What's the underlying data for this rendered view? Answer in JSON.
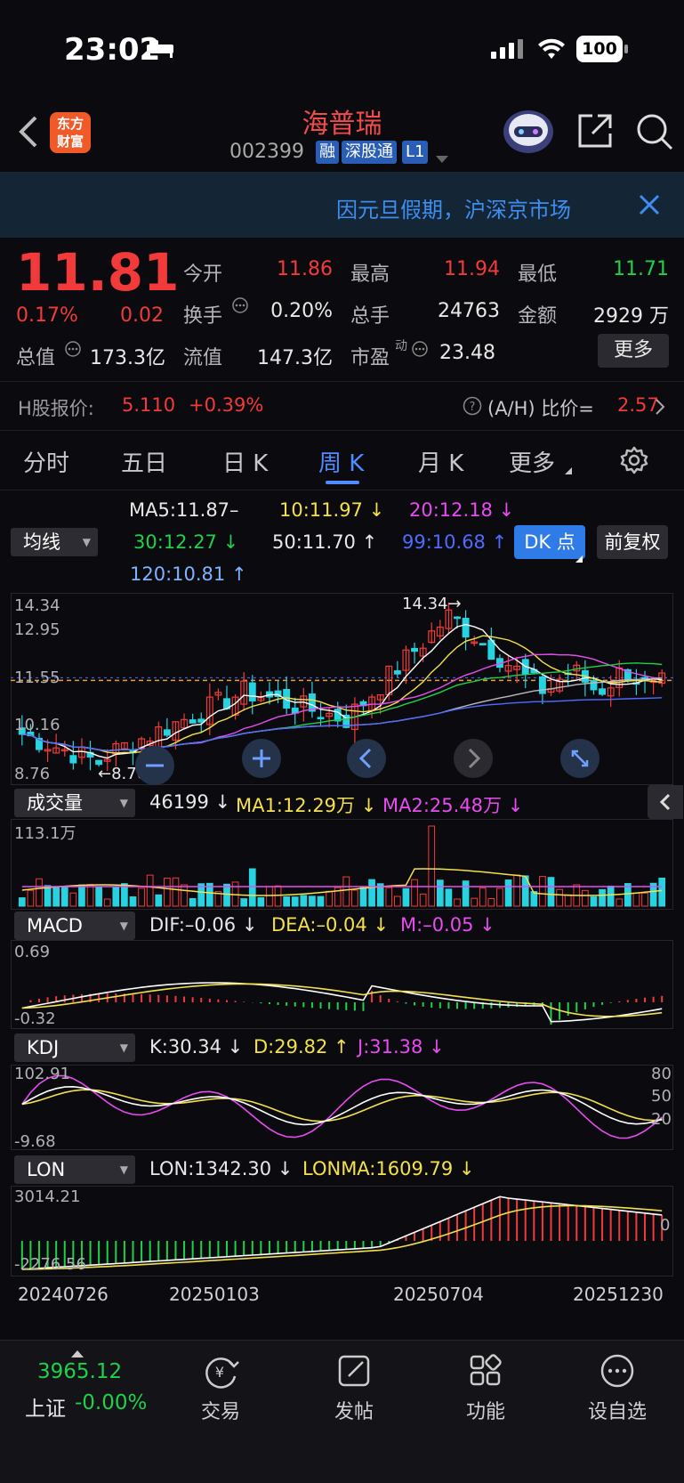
{
  "status": {
    "time": "23:02",
    "battery": "100"
  },
  "header": {
    "name": "海普瑞",
    "code": "002399",
    "tags": [
      "融",
      "深股通",
      "L1"
    ],
    "logo": [
      "东方",
      "财富"
    ]
  },
  "notice": {
    "text": "因元旦假期，沪深京市场"
  },
  "quote": {
    "price": "11.81",
    "change_pct": "0.17%",
    "change": "0.02",
    "open_label": "今开",
    "open": "11.86",
    "high_label": "最高",
    "high": "11.94",
    "low_label": "最低",
    "low": "11.71",
    "turnover_label": "换手",
    "turnover": "0.20%",
    "volume_label": "总手",
    "volume": "24763",
    "amount_label": "金额",
    "amount": "2929 万",
    "mktcap_label": "总值",
    "mktcap": "173.3亿",
    "float_label": "流值",
    "float": "147.3亿",
    "pe_label": "市盈",
    "pe_sup": "动",
    "pe": "23.48",
    "more": "更多"
  },
  "hshare": {
    "label": "H股报价:",
    "price": "5.110",
    "change": "+0.39%",
    "ratio_label": "(A/H) 比价=",
    "ratio": "2.57"
  },
  "tabs": [
    "分时",
    "五日",
    "日 K",
    "周 K",
    "月 K",
    "更多"
  ],
  "ma": {
    "select": "均线",
    "ma5": "MA5:11.87–",
    "ma10": "10:11.97 ↓",
    "ma20": "20:12.18 ↓",
    "ma30": "30:12.27 ↓",
    "ma50": "50:11.70 ↑",
    "ma99": "99:10.68 ↑",
    "ma120": "120:10.81 ↑",
    "dk": "DK 点",
    "fq": "前复权"
  },
  "kline": {
    "axis": [
      "14.34",
      "12.95",
      "11.55",
      "10.16",
      "8.76"
    ],
    "max_label": "14.34→",
    "min_label": "←8.76",
    "current": 11.81
  },
  "volume": {
    "select": "成交量",
    "value": "46199 ↓",
    "ma1": "MA1:12.29万 ↓",
    "ma2": "MA2:25.48万 ↓",
    "axis_max": "113.1万"
  },
  "macd": {
    "select": "MACD",
    "dif": "DIF:–0.06 ↓",
    "dea": "DEA:–0.04 ↓",
    "m": "M:–0.05 ↓",
    "axis_max": "0.69",
    "axis_min": "-0.32"
  },
  "kdj": {
    "select": "KDJ",
    "k": "K:30.34 ↓",
    "d": "D:29.82 ↑",
    "j": "J:31.38 ↓",
    "axis_max": "102.91",
    "axis_min": "-9.68",
    "r80": "80",
    "r50": "50",
    "r20": "20"
  },
  "lon": {
    "select": "LON",
    "lon": "LON:1342.30 ↓",
    "lonma": "LONMA:1609.79 ↓",
    "axis_max": "3014.21",
    "axis_min": "-2276.56",
    "r0": "0"
  },
  "dates": [
    "20240726",
    "20250103",
    "20250704",
    "20251230"
  ],
  "bottom": {
    "index_value": "3965.12",
    "index_name": "上证",
    "index_change": "-0.00%",
    "nav": [
      "交易",
      "发帖",
      "功能",
      "设自选"
    ]
  },
  "colors": {
    "up": "#f23a3a",
    "down": "#1fd04a",
    "accent": "#4f8cff",
    "ma5": "#ffffff",
    "ma10": "#f4e04a",
    "ma20": "#e84cf0",
    "ma30": "#1fd04a",
    "ma99": "#4f6bff"
  }
}
